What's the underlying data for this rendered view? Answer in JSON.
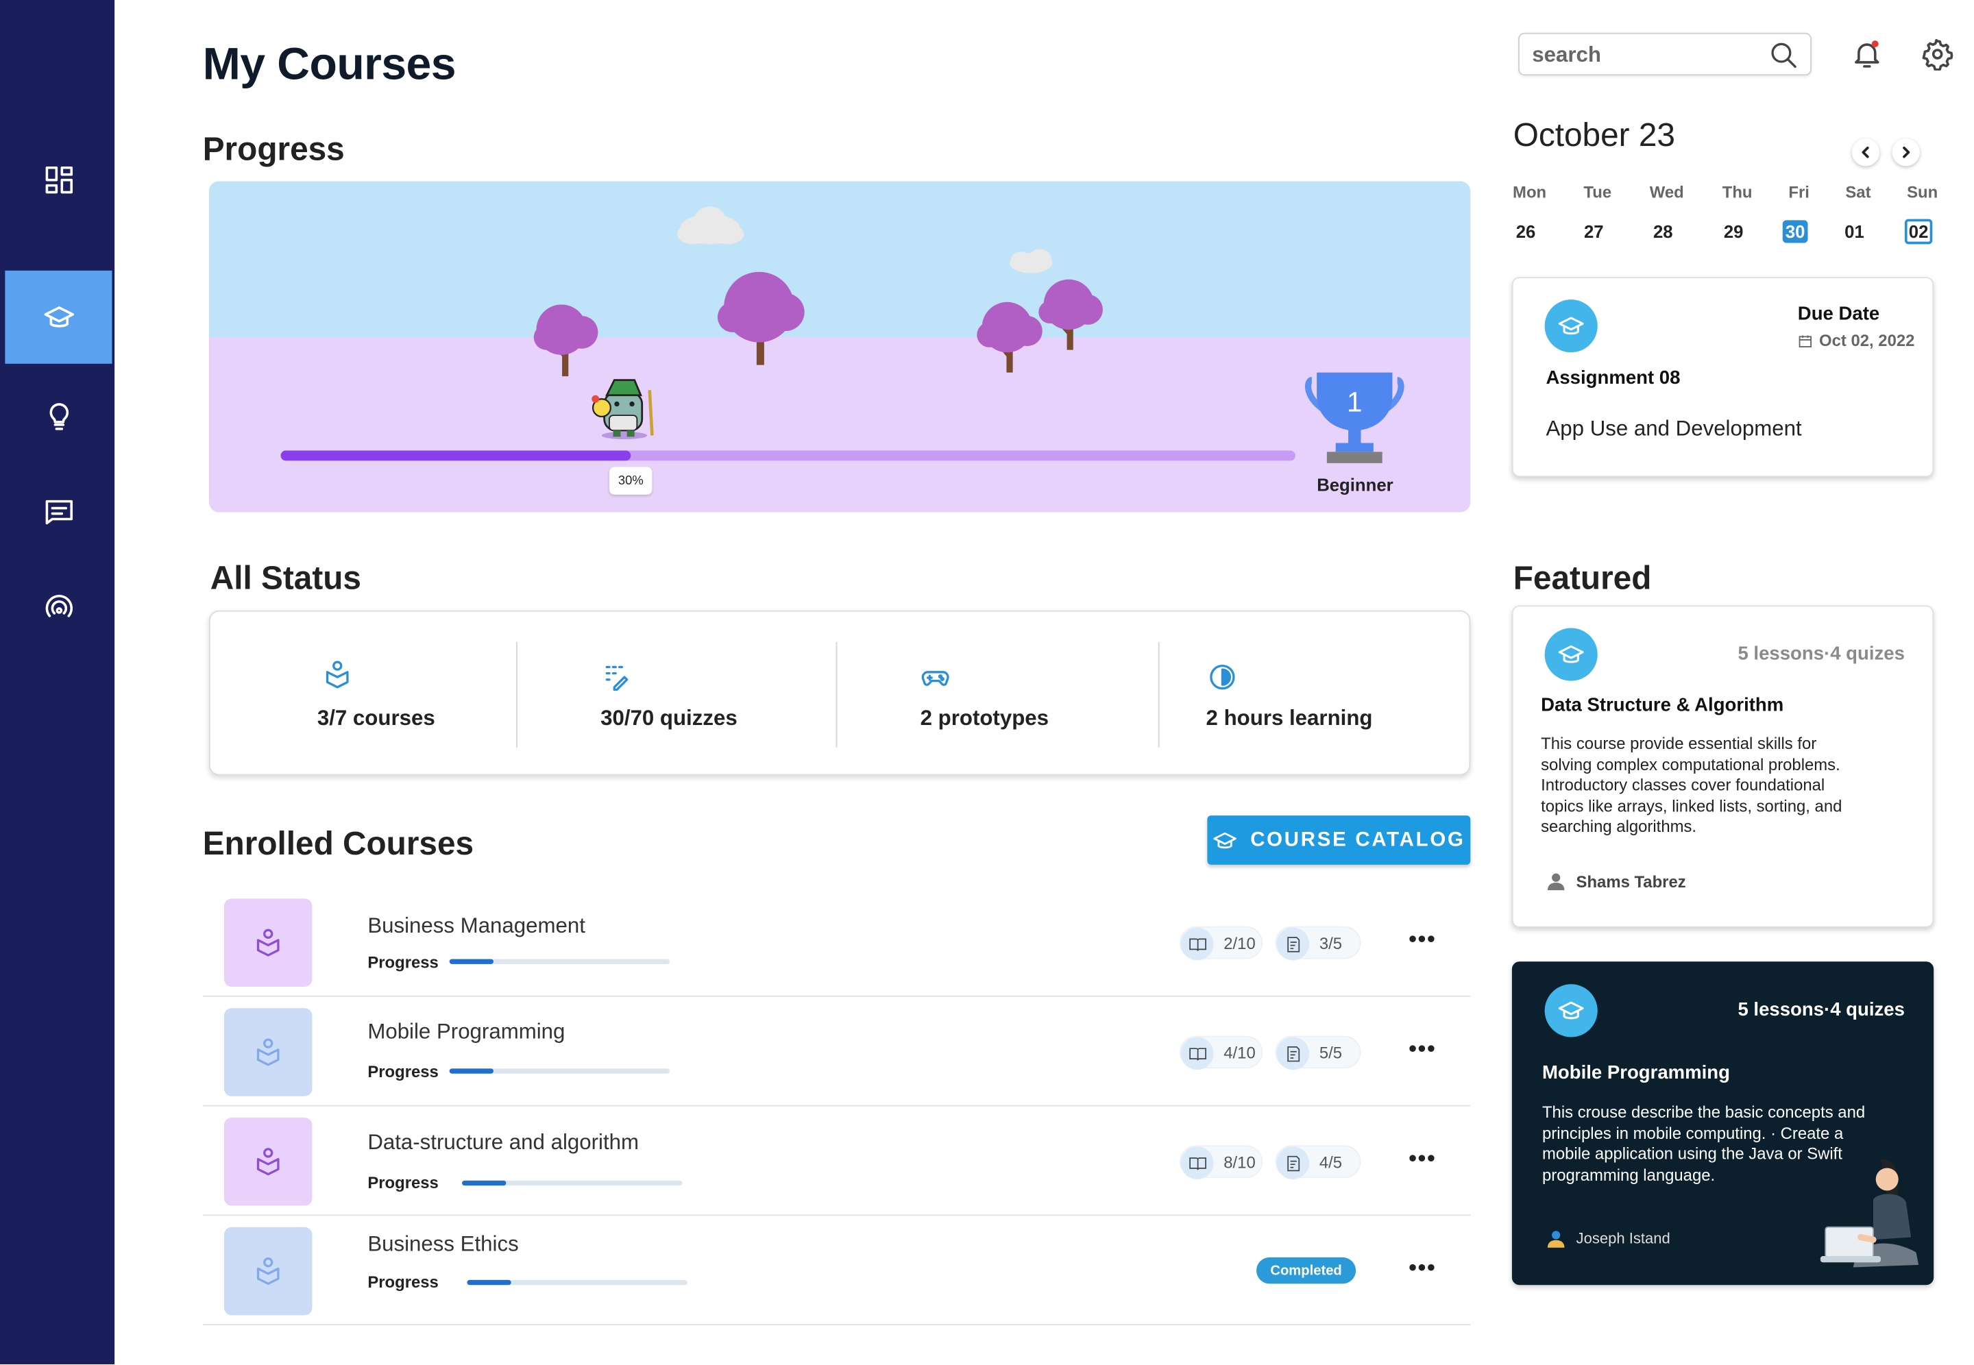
{
  "page": {
    "title": "My Courses"
  },
  "sidebar": {
    "items": [
      {
        "name": "dashboard",
        "icon": "dashboard-icon",
        "active": false
      },
      {
        "name": "courses",
        "icon": "graduation-cap-icon",
        "active": true
      },
      {
        "name": "ideas",
        "icon": "lightbulb-icon",
        "active": false
      },
      {
        "name": "messages",
        "icon": "chat-icon",
        "active": false
      },
      {
        "name": "live",
        "icon": "broadcast-icon",
        "active": false
      }
    ]
  },
  "progress": {
    "title": "Progress",
    "percent_label": "30%",
    "percent": 0.3,
    "level": "Beginner",
    "trophy_number": "1"
  },
  "status": {
    "title": "All Status",
    "items": [
      {
        "icon": "course-icon",
        "label": "3/7 courses"
      },
      {
        "icon": "quiz-icon",
        "label": "30/70 quizzes"
      },
      {
        "icon": "gamepad-icon",
        "label": "2 prototypes"
      },
      {
        "icon": "clock-icon",
        "label": "2 hours learning"
      }
    ]
  },
  "enrolled": {
    "title": "Enrolled Courses",
    "catalog_label": "COURSE CATALOG",
    "progress_label": "Progress",
    "completed_label": "Completed",
    "courses": [
      {
        "title": "Business Management",
        "lessons": "2/10",
        "quizzes": "3/5",
        "progress": 0.2,
        "completed": false
      },
      {
        "title": "Mobile Programming",
        "lessons": "4/10",
        "quizzes": "5/5",
        "progress": 0.2,
        "completed": false
      },
      {
        "title": "Data-structure and algorithm",
        "lessons": "8/10",
        "quizzes": "4/5",
        "progress": 0.2,
        "completed": false
      },
      {
        "title": "Business Ethics",
        "lessons": "",
        "quizzes": "",
        "progress": 0.2,
        "completed": true
      }
    ]
  },
  "search": {
    "placeholder": "search"
  },
  "calendar": {
    "month_label": "October 23",
    "days": [
      {
        "name": "Mon",
        "num": "26"
      },
      {
        "name": "Tue",
        "num": "27"
      },
      {
        "name": "Wed",
        "num": "28"
      },
      {
        "name": "Thu",
        "num": "29"
      },
      {
        "name": "Fri",
        "num": "30"
      },
      {
        "name": "Sat",
        "num": "01"
      },
      {
        "name": "Sun",
        "num": "02"
      }
    ]
  },
  "assignment": {
    "due_label": "Due Date",
    "due_date": "Oct 02, 2022",
    "title": "Assignment 08",
    "subtitle": "App Use and Development"
  },
  "featured": {
    "title": "Featured",
    "cards": [
      {
        "meta": "5 lessons·4 quizes",
        "title": "Data Structure & Algorithm",
        "description": "This course provide essential skills for solving complex computational problems. Introductory classes cover foundational topics like arrays, linked lists, sorting, and searching algorithms.",
        "author": "Shams Tabrez"
      },
      {
        "meta": "5 lessons·4 quizes",
        "title": "Mobile Programming",
        "description": "This crouse describe the basic concepts and principles in mobile computing. · Create a mobile application using the Java or Swift programming language.",
        "author": "Joseph Istand"
      }
    ]
  },
  "colors": {
    "sidebar": "#1a1f5c",
    "accent": "#1e9ae0",
    "active_nav": "#5aa1f0",
    "dark_card": "#0c1f2c"
  }
}
